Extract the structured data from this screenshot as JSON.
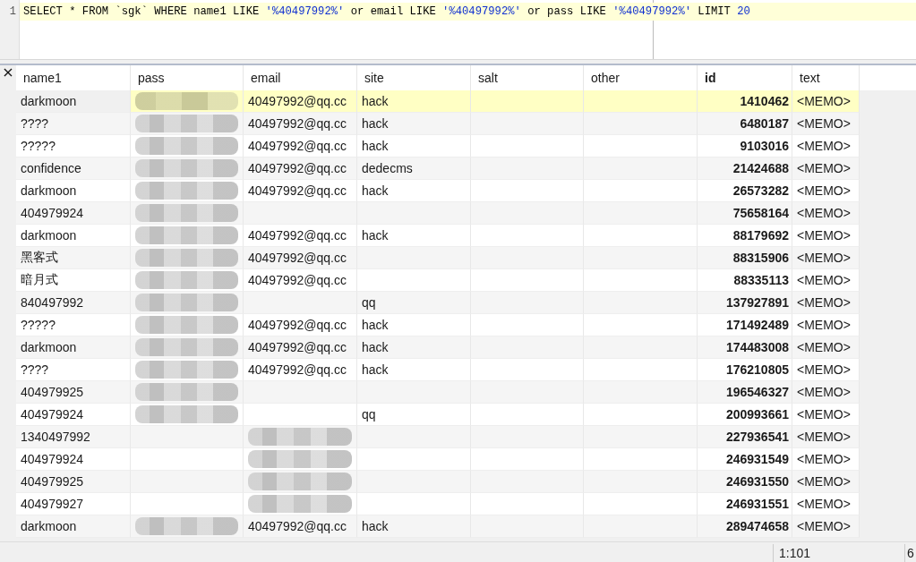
{
  "editor": {
    "line_number": "1",
    "query": [
      {
        "kind": "code",
        "text": "SELECT * FROM `sgk` WHERE name1 LIKE "
      },
      {
        "kind": "literal",
        "text": "'%40497992%'"
      },
      {
        "kind": "code",
        "text": " or email LIKE "
      },
      {
        "kind": "literal",
        "text": "'%40497992%'"
      },
      {
        "kind": "code",
        "text": " or pass LIKE "
      },
      {
        "kind": "literal",
        "text": "'%40497992%'"
      },
      {
        "kind": "code",
        "text": " LIMIT "
      },
      {
        "kind": "literal",
        "text": "20"
      }
    ]
  },
  "results": {
    "close_label": "×",
    "columns": [
      {
        "label": "name1",
        "kind": "text",
        "key_column": false
      },
      {
        "label": "pass",
        "kind": "text",
        "key_column": false
      },
      {
        "label": "email",
        "kind": "text",
        "key_column": false
      },
      {
        "label": "site",
        "kind": "text",
        "key_column": false
      },
      {
        "label": "salt",
        "kind": "text",
        "key_column": false
      },
      {
        "label": "other",
        "kind": "text",
        "key_column": false
      },
      {
        "label": "id",
        "kind": "number",
        "key_column": true
      },
      {
        "label": "text",
        "kind": "text",
        "key_column": false
      }
    ],
    "rows": [
      {
        "selected": true,
        "cells": [
          {
            "text": "darkmoon",
            "blurred": false
          },
          {
            "blurred": true
          },
          {
            "text": "40497992@qq.cc",
            "blurred": false
          },
          {
            "text": "hack",
            "blurred": false
          },
          {
            "blurred": false
          },
          {
            "blurred": false
          },
          {
            "text": "1410462",
            "blurred": false
          },
          {
            "text": "<MEMO>",
            "blurred": false
          }
        ]
      },
      {
        "selected": false,
        "cells": [
          {
            "text": "????",
            "blurred": false
          },
          {
            "blurred": true
          },
          {
            "text": "40497992@qq.cc",
            "blurred": false
          },
          {
            "text": "hack",
            "blurred": false
          },
          {
            "blurred": false
          },
          {
            "blurred": false
          },
          {
            "text": "6480187",
            "blurred": false
          },
          {
            "text": "<MEMO>",
            "blurred": false
          }
        ]
      },
      {
        "selected": false,
        "cells": [
          {
            "text": "?????",
            "blurred": false
          },
          {
            "blurred": true
          },
          {
            "text": "40497992@qq.cc",
            "blurred": false
          },
          {
            "text": "hack",
            "blurred": false
          },
          {
            "blurred": false
          },
          {
            "blurred": false
          },
          {
            "text": "9103016",
            "blurred": false
          },
          {
            "text": "<MEMO>",
            "blurred": false
          }
        ]
      },
      {
        "selected": false,
        "cells": [
          {
            "text": "confidence",
            "blurred": false
          },
          {
            "blurred": true
          },
          {
            "text": "40497992@qq.cc",
            "blurred": false
          },
          {
            "text": "dedecms",
            "blurred": false
          },
          {
            "blurred": false
          },
          {
            "blurred": false
          },
          {
            "text": "21424688",
            "blurred": false
          },
          {
            "text": "<MEMO>",
            "blurred": false
          }
        ]
      },
      {
        "selected": false,
        "cells": [
          {
            "text": "darkmoon",
            "blurred": false
          },
          {
            "blurred": true
          },
          {
            "text": "40497992@qq.cc",
            "blurred": false
          },
          {
            "text": "hack",
            "blurred": false
          },
          {
            "blurred": false
          },
          {
            "blurred": false
          },
          {
            "text": "26573282",
            "blurred": false
          },
          {
            "text": "<MEMO>",
            "blurred": false
          }
        ]
      },
      {
        "selected": false,
        "cells": [
          {
            "text": "404979924",
            "blurred": false
          },
          {
            "blurred": true
          },
          {
            "blurred": false
          },
          {
            "blurred": false
          },
          {
            "blurred": false
          },
          {
            "blurred": false
          },
          {
            "text": "75658164",
            "blurred": false
          },
          {
            "text": "<MEMO>",
            "blurred": false
          }
        ]
      },
      {
        "selected": false,
        "cells": [
          {
            "text": "darkmoon",
            "blurred": false
          },
          {
            "blurred": true
          },
          {
            "text": "40497992@qq.cc",
            "blurred": false
          },
          {
            "text": "hack",
            "blurred": false
          },
          {
            "blurred": false
          },
          {
            "blurred": false
          },
          {
            "text": "88179692",
            "blurred": false
          },
          {
            "text": "<MEMO>",
            "blurred": false
          }
        ]
      },
      {
        "selected": false,
        "cells": [
          {
            "text": "黑客式",
            "blurred": false
          },
          {
            "blurred": true
          },
          {
            "text": "40497992@qq.cc",
            "blurred": false
          },
          {
            "blurred": false
          },
          {
            "blurred": false
          },
          {
            "blurred": false
          },
          {
            "text": "88315906",
            "blurred": false
          },
          {
            "text": "<MEMO>",
            "blurred": false
          }
        ]
      },
      {
        "selected": false,
        "cells": [
          {
            "text": "暗月式",
            "blurred": false
          },
          {
            "blurred": true
          },
          {
            "text": "40497992@qq.cc",
            "blurred": false
          },
          {
            "blurred": false
          },
          {
            "blurred": false
          },
          {
            "blurred": false
          },
          {
            "text": "88335113",
            "blurred": false
          },
          {
            "text": "<MEMO>",
            "blurred": false
          }
        ]
      },
      {
        "selected": false,
        "cells": [
          {
            "text": "840497992",
            "blurred": false
          },
          {
            "blurred": true
          },
          {
            "blurred": false
          },
          {
            "text": "qq",
            "blurred": false
          },
          {
            "blurred": false
          },
          {
            "blurred": false
          },
          {
            "text": "137927891",
            "blurred": false
          },
          {
            "text": "<MEMO>",
            "blurred": false
          }
        ]
      },
      {
        "selected": false,
        "cells": [
          {
            "text": "?????",
            "blurred": false
          },
          {
            "blurred": true
          },
          {
            "text": "40497992@qq.cc",
            "blurred": false
          },
          {
            "text": "hack",
            "blurred": false
          },
          {
            "blurred": false
          },
          {
            "blurred": false
          },
          {
            "text": "171492489",
            "blurred": false
          },
          {
            "text": "<MEMO>",
            "blurred": false
          }
        ]
      },
      {
        "selected": false,
        "cells": [
          {
            "text": "darkmoon",
            "blurred": false
          },
          {
            "blurred": true
          },
          {
            "text": "40497992@qq.cc",
            "blurred": false
          },
          {
            "text": "hack",
            "blurred": false
          },
          {
            "blurred": false
          },
          {
            "blurred": false
          },
          {
            "text": "174483008",
            "blurred": false
          },
          {
            "text": "<MEMO>",
            "blurred": false
          }
        ]
      },
      {
        "selected": false,
        "cells": [
          {
            "text": "????",
            "blurred": false
          },
          {
            "blurred": true
          },
          {
            "text": "40497992@qq.cc",
            "blurred": false
          },
          {
            "text": "hack",
            "blurred": false
          },
          {
            "blurred": false
          },
          {
            "blurred": false
          },
          {
            "text": "176210805",
            "blurred": false
          },
          {
            "text": "<MEMO>",
            "blurred": false
          }
        ]
      },
      {
        "selected": false,
        "cells": [
          {
            "text": "404979925",
            "blurred": false
          },
          {
            "blurred": true
          },
          {
            "blurred": false
          },
          {
            "blurred": false
          },
          {
            "blurred": false
          },
          {
            "blurred": false
          },
          {
            "text": "196546327",
            "blurred": false
          },
          {
            "text": "<MEMO>",
            "blurred": false
          }
        ]
      },
      {
        "selected": false,
        "cells": [
          {
            "text": "404979924",
            "blurred": false
          },
          {
            "blurred": true
          },
          {
            "blurred": false
          },
          {
            "text": "qq",
            "blurred": false
          },
          {
            "blurred": false
          },
          {
            "blurred": false
          },
          {
            "text": "200993661",
            "blurred": false
          },
          {
            "text": "<MEMO>",
            "blurred": false
          }
        ]
      },
      {
        "selected": false,
        "cells": [
          {
            "text": "1340497992",
            "blurred": false
          },
          {
            "blurred": false
          },
          {
            "blurred": true
          },
          {
            "blurred": false
          },
          {
            "blurred": false
          },
          {
            "blurred": false
          },
          {
            "text": "227936541",
            "blurred": false
          },
          {
            "text": "<MEMO>",
            "blurred": false
          }
        ]
      },
      {
        "selected": false,
        "cells": [
          {
            "text": "404979924",
            "blurred": false
          },
          {
            "blurred": false
          },
          {
            "blurred": true
          },
          {
            "blurred": false
          },
          {
            "blurred": false
          },
          {
            "blurred": false
          },
          {
            "text": "246931549",
            "blurred": false
          },
          {
            "text": "<MEMO>",
            "blurred": false
          }
        ]
      },
      {
        "selected": false,
        "cells": [
          {
            "text": "404979925",
            "blurred": false
          },
          {
            "blurred": false
          },
          {
            "blurred": true
          },
          {
            "blurred": false
          },
          {
            "blurred": false
          },
          {
            "blurred": false
          },
          {
            "text": "246931550",
            "blurred": false
          },
          {
            "text": "<MEMO>",
            "blurred": false
          }
        ]
      },
      {
        "selected": false,
        "cells": [
          {
            "text": "404979927",
            "blurred": false
          },
          {
            "blurred": false
          },
          {
            "blurred": true
          },
          {
            "blurred": false
          },
          {
            "blurred": false
          },
          {
            "blurred": false
          },
          {
            "text": "246931551",
            "blurred": false
          },
          {
            "text": "<MEMO>",
            "blurred": false
          }
        ]
      },
      {
        "selected": false,
        "cells": [
          {
            "text": "darkmoon",
            "blurred": false
          },
          {
            "blurred": true
          },
          {
            "text": "40497992@qq.cc",
            "blurred": false
          },
          {
            "text": "hack",
            "blurred": false
          },
          {
            "blurred": false
          },
          {
            "blurred": false
          },
          {
            "text": "289474658",
            "blurred": false
          },
          {
            "text": "<MEMO>",
            "blurred": false
          }
        ]
      }
    ]
  },
  "status_bar": {
    "position": "1:101",
    "next": "6"
  }
}
